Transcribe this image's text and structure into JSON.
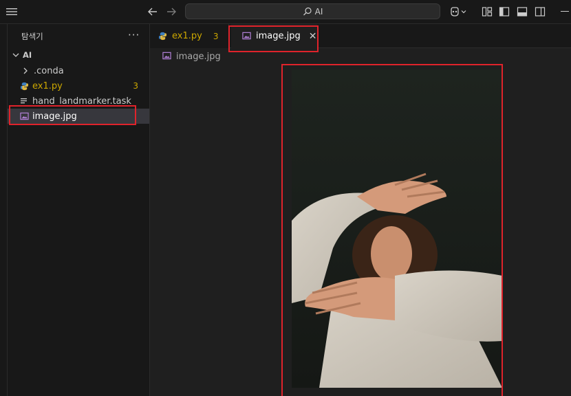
{
  "titlebar": {
    "search_text": "AI"
  },
  "sidebar": {
    "title": "탐색기",
    "more_label": "···",
    "root": {
      "label": "AI"
    },
    "items": [
      {
        "label": ".conda",
        "type": "folder",
        "badge": ""
      },
      {
        "label": "ex1.py",
        "type": "python",
        "badge": "3"
      },
      {
        "label": "hand_landmarker.task",
        "type": "file",
        "badge": ""
      },
      {
        "label": "image.jpg",
        "type": "image",
        "badge": ""
      }
    ]
  },
  "tabs": [
    {
      "label": "ex1.py",
      "badge": "3",
      "active": false
    },
    {
      "label": "image.jpg",
      "close": "✕",
      "active": true
    }
  ],
  "breadcrumb": {
    "label": "image.jpg"
  },
  "colors": {
    "warning": "#cca700",
    "annotation": "#e0232b",
    "image_icon": "#b180d7",
    "python_icon": "#3d7ebf"
  }
}
